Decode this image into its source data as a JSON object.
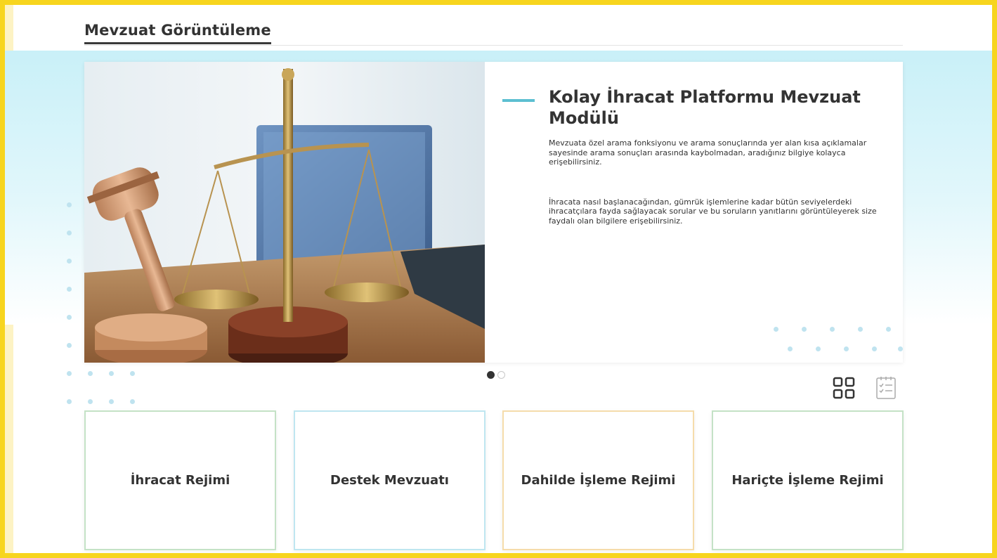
{
  "page": {
    "title": "Mevzuat Görüntüleme",
    "frame_color": "#f7d51e",
    "accent_color": "#5cbfd1"
  },
  "hero": {
    "title": "Kolay İhracat Platformu Mevzuat Modülü",
    "paragraph_1": "Mevzuata özel arama fonksiyonu ve arama sonuçlarında yer alan kısa açıklamalar sayesinde arama sonuçları arasında kaybolmadan, aradığınız bilgiye kolayca erişebilirsiniz.",
    "paragraph_2": "İhracata nasıl başlanacağından, gümrük işlemlerine kadar bütün seviyelerdeki ihracatçılara fayda sağlayacak sorular ve bu soruların yanıtlarını görüntüleyerek size faydalı olan bilgilere erişebilirsiniz.",
    "image": "scales-of-justice-and-gavel-photo"
  },
  "carousel": {
    "slide_count": 2,
    "active_index": 0
  },
  "view_toggle": {
    "grid_icon": "grid-view-icon",
    "list_icon": "checklist-view-icon"
  },
  "tiles": [
    {
      "label": "İhracat Rejimi",
      "border_color": "#c4e2c6"
    },
    {
      "label": "Destek Mevzuatı",
      "border_color": "#bfe6f0"
    },
    {
      "label": "Dahilde İşleme Rejimi",
      "border_color": "#f5dcab"
    },
    {
      "label": "Hariçte İşleme Rejimi",
      "border_color": "#c4e2c6"
    }
  ]
}
